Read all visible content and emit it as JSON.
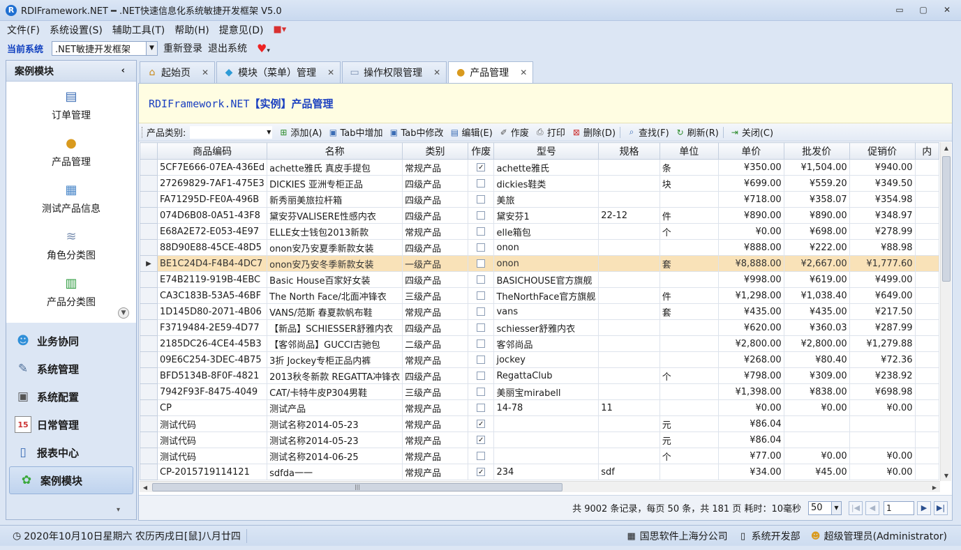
{
  "window": {
    "logo": "R",
    "title": "RDIFramework.NET ━ .NET快速信息化系统敏捷开发框架 V5.0",
    "controls": [
      "▭",
      "▢",
      "✕"
    ]
  },
  "menu": {
    "items": [
      "文件(F)",
      "系统设置(S)",
      "辅助工具(T)",
      "帮助(H)",
      "提意见(D)"
    ]
  },
  "system_bar": {
    "label": "当前系统",
    "current_system": ".NET敏捷开发框架",
    "relogin": "重新登录",
    "exit": "退出系统"
  },
  "sidebar": {
    "title": "案例模块",
    "items": [
      {
        "label": "订单管理",
        "icon": "order-icon"
      },
      {
        "label": "产品管理",
        "icon": "product-icon"
      },
      {
        "label": "测试产品信息",
        "icon": "grid-icon"
      },
      {
        "label": "角色分类图",
        "icon": "chart-icon"
      },
      {
        "label": "产品分类图",
        "icon": "bar-chart-icon"
      }
    ],
    "groups": [
      {
        "label": "业务协同",
        "icon": "people-icon"
      },
      {
        "label": "系统管理",
        "icon": "wrench-icon"
      },
      {
        "label": "系统配置",
        "icon": "config-icon"
      },
      {
        "label": "日常管理",
        "icon": "calendar-icon",
        "glyph": "15"
      },
      {
        "label": "报表中心",
        "icon": "report-icon"
      },
      {
        "label": "案例模块",
        "icon": "flower-icon",
        "active": true
      }
    ]
  },
  "tabs": [
    {
      "label": "起始页",
      "icon": "home-icon",
      "active": false
    },
    {
      "label": "模块（菜单）管理",
      "icon": "module-icon",
      "active": false
    },
    {
      "label": "操作权限管理",
      "icon": "window-icon",
      "active": false
    },
    {
      "label": "产品管理",
      "icon": "product-icon",
      "active": true
    }
  ],
  "banner": {
    "prefix": "RDIFramework.NET",
    "title": "【实例】产品管理"
  },
  "toolbar": {
    "category_label": "产品类别:",
    "buttons": [
      {
        "label": "添加(A)",
        "icon": "add-icon"
      },
      {
        "label": "Tab中增加",
        "icon": "tab-add-icon"
      },
      {
        "label": "Tab中修改",
        "icon": "tab-edit-icon"
      },
      {
        "label": "编辑(E)",
        "icon": "edit-icon"
      },
      {
        "label": "作废",
        "icon": "void-icon"
      },
      {
        "label": "打印",
        "icon": "print-icon"
      },
      {
        "label": "删除(D)",
        "icon": "delete-icon"
      },
      {
        "label": "查找(F)",
        "icon": "find-icon"
      },
      {
        "label": "刷新(R)",
        "icon": "refresh-icon"
      },
      {
        "label": "关闭(C)",
        "icon": "close-icon"
      }
    ]
  },
  "grid": {
    "columns": [
      "商品编码",
      "名称",
      "类别",
      "作废",
      "型号",
      "规格",
      "单位",
      "单价",
      "批发价",
      "促销价",
      "内"
    ],
    "rows": [
      {
        "code": "5CF7E666-07EA-436Ed",
        "name": "achette雅氏 真皮手提包",
        "category": "常规产品",
        "void": true,
        "model": "achette雅氏",
        "spec": "",
        "unit": "条",
        "price": "¥350.00",
        "wholesale": "¥1,504.00",
        "promo": "¥940.00"
      },
      {
        "code": "27269829-7AF1-475E3",
        "name": "DICKIES 亚洲专柜正品",
        "category": "四级产品",
        "void": false,
        "model": "dickies鞋类",
        "spec": "",
        "unit": "块",
        "price": "¥699.00",
        "wholesale": "¥559.20",
        "promo": "¥349.50"
      },
      {
        "code": "FA71295D-FE0A-496B",
        "name": "新秀丽美旅拉杆箱",
        "category": "四级产品",
        "void": false,
        "model": "美旅",
        "spec": "",
        "unit": "",
        "price": "¥718.00",
        "wholesale": "¥358.07",
        "promo": "¥354.98"
      },
      {
        "code": "074D6B08-0A51-43F8",
        "name": "黛安芬VALISERE性感内衣",
        "category": "四级产品",
        "void": false,
        "model": "黛安芬1",
        "spec": "22-12",
        "unit": "件",
        "price": "¥890.00",
        "wholesale": "¥890.00",
        "promo": "¥348.97"
      },
      {
        "code": "E68A2E72-E053-4E97",
        "name": "ELLE女士钱包2013新款",
        "category": "常规产品",
        "void": false,
        "model": "elle箱包",
        "spec": "",
        "unit": "个",
        "price": "¥0.00",
        "wholesale": "¥698.00",
        "promo": "¥278.99"
      },
      {
        "code": "88D90E88-45CE-48D5",
        "name": "onon安乃安夏季新款女装",
        "category": "四级产品",
        "void": false,
        "model": "onon",
        "spec": "",
        "unit": "",
        "price": "¥888.00",
        "wholesale": "¥222.00",
        "promo": "¥88.98"
      },
      {
        "code": "BE1C24D4-F4B4-4DC7",
        "name": "onon安乃安冬季新款女装",
        "category": "一级产品",
        "void": false,
        "model": "onon",
        "spec": "",
        "unit": "套",
        "price": "¥8,888.00",
        "wholesale": "¥2,667.00",
        "promo": "¥1,777.60",
        "selected": true
      },
      {
        "code": "E74B2119-919B-4EBC",
        "name": "Basic House百家好女装",
        "category": "四级产品",
        "void": false,
        "model": "BASICHOUSE官方旗舰",
        "spec": "",
        "unit": "",
        "price": "¥998.00",
        "wholesale": "¥619.00",
        "promo": "¥499.00"
      },
      {
        "code": "CA3C183B-53A5-46BF",
        "name": "The North Face/北面冲锋衣",
        "category": "三级产品",
        "void": false,
        "model": "TheNorthFace官方旗舰",
        "spec": "",
        "unit": "件",
        "price": "¥1,298.00",
        "wholesale": "¥1,038.40",
        "promo": "¥649.00"
      },
      {
        "code": "1D145D80-2071-4B06",
        "name": "VANS/范斯 春夏款帆布鞋",
        "category": "常规产品",
        "void": false,
        "model": "vans",
        "spec": "",
        "unit": "套",
        "price": "¥435.00",
        "wholesale": "¥435.00",
        "promo": "¥217.50"
      },
      {
        "code": "F3719484-2E59-4D77",
        "name": "【新品】SCHIESSER舒雅内衣",
        "category": "四级产品",
        "void": false,
        "model": "schiesser舒雅内衣",
        "spec": "",
        "unit": "",
        "price": "¥620.00",
        "wholesale": "¥360.03",
        "promo": "¥287.99"
      },
      {
        "code": "2185DC26-4CE4-45B3",
        "name": "【客邻尚品】GUCCI古驰包",
        "category": "二级产品",
        "void": false,
        "model": "客邻尚品",
        "spec": "",
        "unit": "",
        "price": "¥2,800.00",
        "wholesale": "¥2,800.00",
        "promo": "¥1,279.88"
      },
      {
        "code": "09E6C254-3DEC-4B75",
        "name": "3折 Jockey专柜正品内裤",
        "category": "常规产品",
        "void": false,
        "model": "jockey",
        "spec": "",
        "unit": "",
        "price": "¥268.00",
        "wholesale": "¥80.40",
        "promo": "¥72.36"
      },
      {
        "code": "BFD5134B-8F0F-4821",
        "name": "2013秋冬新款 REGATTA冲锋衣",
        "category": "四级产品",
        "void": false,
        "model": "RegattaClub",
        "spec": "",
        "unit": "个",
        "price": "¥798.00",
        "wholesale": "¥309.00",
        "promo": "¥238.92"
      },
      {
        "code": "7942F93F-8475-4049",
        "name": "CAT/卡特牛皮P304男鞋",
        "category": "三级产品",
        "void": false,
        "model": "美丽宝mirabell",
        "spec": "",
        "unit": "",
        "price": "¥1,398.00",
        "wholesale": "¥838.00",
        "promo": "¥698.98"
      },
      {
        "code": "CP",
        "name": "测试产品",
        "category": "常规产品",
        "void": false,
        "model": "14-78",
        "spec": "11",
        "unit": "",
        "price": "¥0.00",
        "wholesale": "¥0.00",
        "promo": "¥0.00"
      },
      {
        "code": "测试代码",
        "name": "测试名称2014-05-23",
        "category": "常规产品",
        "void": true,
        "model": "",
        "spec": "",
        "unit": "元",
        "price": "¥86.04",
        "wholesale": "",
        "promo": ""
      },
      {
        "code": "测试代码",
        "name": "测试名称2014-05-23",
        "category": "常规产品",
        "void": true,
        "model": "",
        "spec": "",
        "unit": "元",
        "price": "¥86.04",
        "wholesale": "",
        "promo": ""
      },
      {
        "code": "测试代码",
        "name": "测试名称2014-06-25",
        "category": "常规产品",
        "void": false,
        "model": "",
        "spec": "",
        "unit": "个",
        "price": "¥77.00",
        "wholesale": "¥0.00",
        "promo": "¥0.00"
      },
      {
        "code": "CP-2015719114121",
        "name": "sdfda一一",
        "category": "常规产品",
        "void": true,
        "model": "234",
        "spec": "sdf",
        "unit": "",
        "price": "¥34.00",
        "wholesale": "¥45.00",
        "promo": "¥0.00"
      }
    ]
  },
  "pager": {
    "info": "共 9002 条记录，每页 50 条，共 181 页 耗时：10毫秒",
    "page_size": "50",
    "current_page": "1"
  },
  "statusbar": {
    "date": "2020年10月10日星期六 农历丙戌日[鼠]八月廿四",
    "company": "国思软件上海分公司",
    "department": "系统开发部",
    "user": "超级管理员(Administrator)"
  },
  "colors": {
    "accent": "#1a3fc0",
    "selected_row": "#f9e2b8",
    "banner_bg": "#fffde2"
  }
}
